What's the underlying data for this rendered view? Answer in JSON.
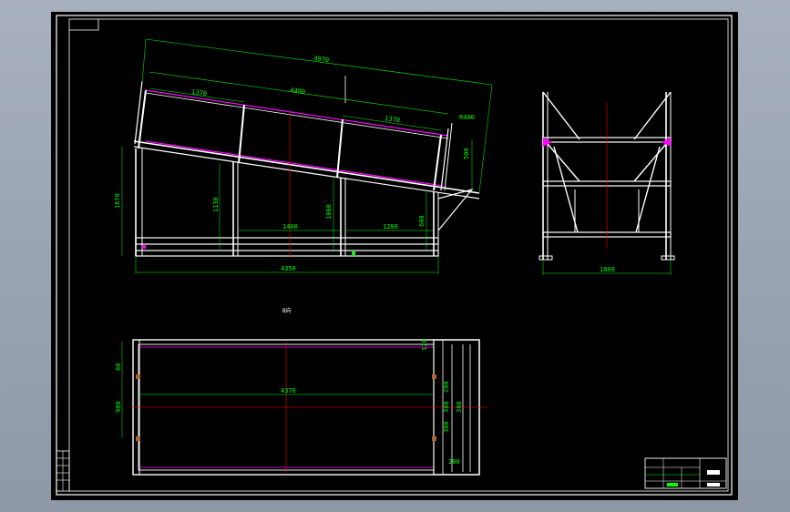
{
  "drawing": {
    "background": "#000000",
    "frame_color": "#ffffff",
    "part_color": "#ffffff",
    "highlight_color": "#ff00ff",
    "dimension_color": "#00ff00",
    "centerline_color": "#ff0000"
  },
  "front_view": {
    "overall_length": "4970",
    "inner_length": "4490",
    "span_left": "1370",
    "span_right": "1370",
    "vertical_right": "500",
    "corner_note": "R400",
    "height_left": "1670",
    "height_mid_left": "1130",
    "height_mid": "1000",
    "height_right": "600",
    "bay_mid": "1400",
    "bay_right": "1200",
    "base_length": "4350"
  },
  "side_view": {
    "width": "1800"
  },
  "plan_view": {
    "label": "B向",
    "length": "4370",
    "left_top": "80",
    "left_mid": "900",
    "right_top": "170",
    "right_dims": [
      "200",
      "300",
      "300",
      "300",
      "200"
    ]
  },
  "title_block": {
    "present": true
  }
}
